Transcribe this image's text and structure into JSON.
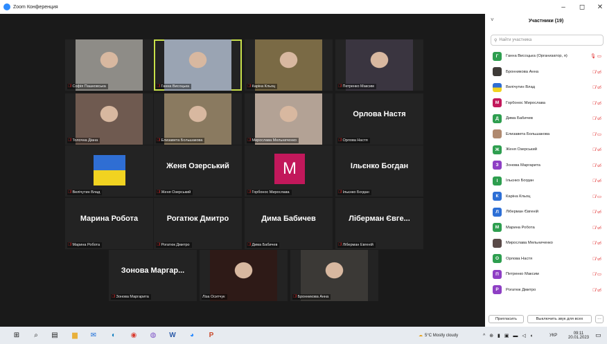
{
  "window": {
    "title": "Zoom Конференция",
    "minimize": "–",
    "maximize": "◻",
    "close": "✕"
  },
  "gallery": {
    "tiles": [
      {
        "name": "Софія Пашковська",
        "video": true,
        "bg": "#8e8c87"
      },
      {
        "name": "Ганна Висоцька",
        "video": true,
        "bg": "#9aa4b3",
        "active": true
      },
      {
        "name": "Каріна Кльоц",
        "video": true,
        "bg": "#7a6a45"
      },
      {
        "name": "Петренко Максим",
        "video": true,
        "bg": "#3a3540"
      },
      {
        "name": "Толочна Діана",
        "video": true,
        "bg": "#6f5a50"
      },
      {
        "name": "Елизавета Большакова",
        "video": true,
        "bg": "#8a7a60"
      },
      {
        "name": "Мирослава Мельниченко",
        "video": true,
        "bg": "#b3a295"
      },
      {
        "name": "Орлова Настя",
        "big": "Орлова Настя"
      },
      {
        "name": "Велічутин Влад",
        "flag": true
      },
      {
        "name": "Женя Озерський",
        "big": "Женя Озерський"
      },
      {
        "name": "Горбонос Мирослава",
        "letter": "M"
      },
      {
        "name": "Ільєнко Богдан",
        "big": "Ільєнко Богдан"
      },
      {
        "name": "Марина Робота",
        "big": "Марина Робота"
      },
      {
        "name": "Рогатюк Дмитро",
        "big": "Рогатюк Дмитро"
      },
      {
        "name": "Дима Бабичев",
        "big": "Дима Бабичев"
      },
      {
        "name": "Ліберман Евгеній",
        "big": "Ліберман Євге..."
      },
      {
        "name": "Зонова Маргарита",
        "big": "Зонова Маргар..."
      },
      {
        "name": "Ліза Оситчук",
        "video": true,
        "bg": "#2e1a17",
        "nomic": true
      },
      {
        "name": "Бронникова Анна",
        "video": true,
        "bg": "#3b3936"
      }
    ]
  },
  "panel": {
    "chevron": "˅",
    "title": "Участники (19)",
    "search_icon": "search-icon",
    "search_placeholder": "Найти участника",
    "participants": [
      {
        "initial": "Г",
        "color": "#2e9e4f",
        "name": "Ганна Висоцька (Организатор, я)",
        "icons": "🎙 ▭",
        "grey": true
      },
      {
        "initial": "",
        "color": "#3e3a37",
        "name": "Бронникова Анна",
        "icons": "🎙̸ ▭̸"
      },
      {
        "initial": "",
        "color": "flag",
        "name": "Велічутин Влад",
        "icons": "🎙̸ ▭̸"
      },
      {
        "initial": "M",
        "color": "#c2185b",
        "name": "Горбонос Мирослава",
        "icons": "🎙̸ ▭̸"
      },
      {
        "initial": "Д",
        "color": "#2e9e4f",
        "name": "Дима Бабичев",
        "icons": "🎙̸ ▭̸"
      },
      {
        "initial": "",
        "color": "#b08a70",
        "name": "Елизавета Большакова",
        "icons": "🎙̸ ▭",
        "grey": true
      },
      {
        "initial": "Ж",
        "color": "#2e9e4f",
        "name": "Женя Озерський",
        "icons": "🎙̸ ▭̸"
      },
      {
        "initial": "З",
        "color": "#8e3fc4",
        "name": "Зонова Маргарита",
        "icons": "🎙̸ ▭̸"
      },
      {
        "initial": "І",
        "color": "#2e9e4f",
        "name": "Ільєнко Богдан",
        "icons": "🎙̸ ▭̸"
      },
      {
        "initial": "К",
        "color": "#2d6fd6",
        "name": "Каріна Кльоц",
        "icons": "🎙̸ ▭",
        "grey": true
      },
      {
        "initial": "Л",
        "color": "#2d6fd6",
        "name": "Ліберман Євгеній",
        "icons": "🎙̸ ▭̸"
      },
      {
        "initial": "М",
        "color": "#2e9e4f",
        "name": "Марина Робота",
        "icons": "🎙̸ ▭̸"
      },
      {
        "initial": "",
        "color": "#5a4a48",
        "name": "Мирослава Мельниченко",
        "icons": "🎙̸ ▭̸"
      },
      {
        "initial": "О",
        "color": "#2e9e4f",
        "name": "Орлова Настя",
        "icons": "🎙̸ ▭̸"
      },
      {
        "initial": "П",
        "color": "#8e3fc4",
        "name": "Петренко Максим",
        "icons": "🎙̸ ▭",
        "grey": true
      },
      {
        "initial": "Р",
        "color": "#8e3fc4",
        "name": "Рогатюк Дмитро",
        "icons": "🎙̸ ▭̸"
      }
    ],
    "invite_label": "Пригласить",
    "mute_all_label": "Выключить звук для всех",
    "more_label": "···"
  },
  "taskbar": {
    "apps": [
      "windows-icon",
      "search-icon",
      "task-view-icon",
      "file-explorer-icon",
      "mail-icon",
      "edge-icon",
      "chrome-icon",
      "viber-icon",
      "word-icon",
      "zoom-icon",
      "powerpoint-icon"
    ],
    "weather": "5°C  Mostly cloudy",
    "language": "УКР",
    "time": "09:11",
    "date": "20.01.2023"
  }
}
